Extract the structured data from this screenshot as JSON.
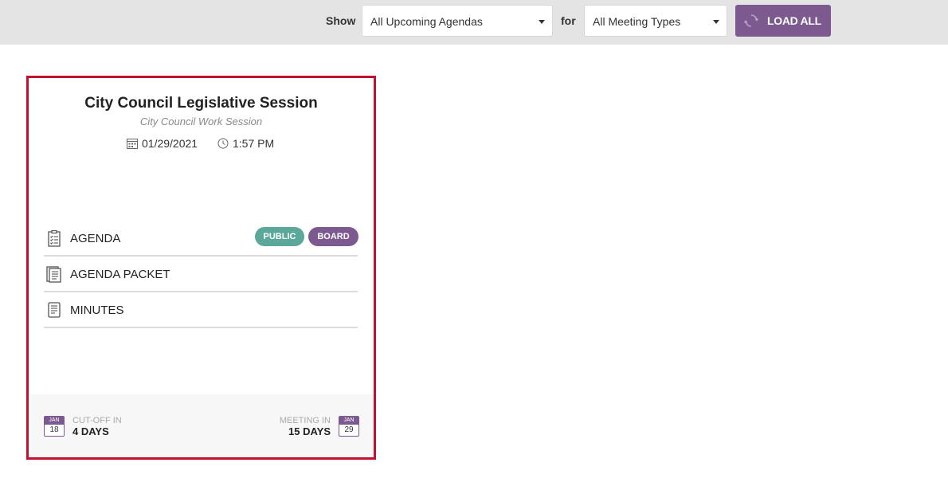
{
  "toolbar": {
    "show_label": "Show",
    "agenda_filter_value": "All Upcoming Agendas",
    "for_label": "for",
    "meeting_type_value": "All Meeting Types",
    "load_all_label": "LOAD ALL",
    "load_icon": "refresh-icon"
  },
  "card": {
    "title": "City Council Legislative Session",
    "subtitle": "City Council Work Session",
    "date": "01/29/2021",
    "time": "1:57 PM",
    "documents": [
      {
        "label": "AGENDA",
        "icon": "clipboard-checklist-icon",
        "badges": [
          "PUBLIC",
          "BOARD"
        ]
      },
      {
        "label": "AGENDA PACKET",
        "icon": "document-stack-icon"
      },
      {
        "label": "MINUTES",
        "icon": "document-lines-icon"
      }
    ],
    "footer": {
      "cutoff_month": "JAN",
      "cutoff_day": "18",
      "cutoff_caption": "CUT-OFF IN",
      "cutoff_value": "4 DAYS",
      "meeting_caption": "MEETING IN",
      "meeting_value": "15 DAYS",
      "meeting_month": "JAN",
      "meeting_day": "29"
    }
  },
  "colors": {
    "accent_purple": "#7c5a8f",
    "public_badge": "#5ba89a",
    "card_border": "#c3102f",
    "topbar_bg": "#e4e4e4"
  }
}
